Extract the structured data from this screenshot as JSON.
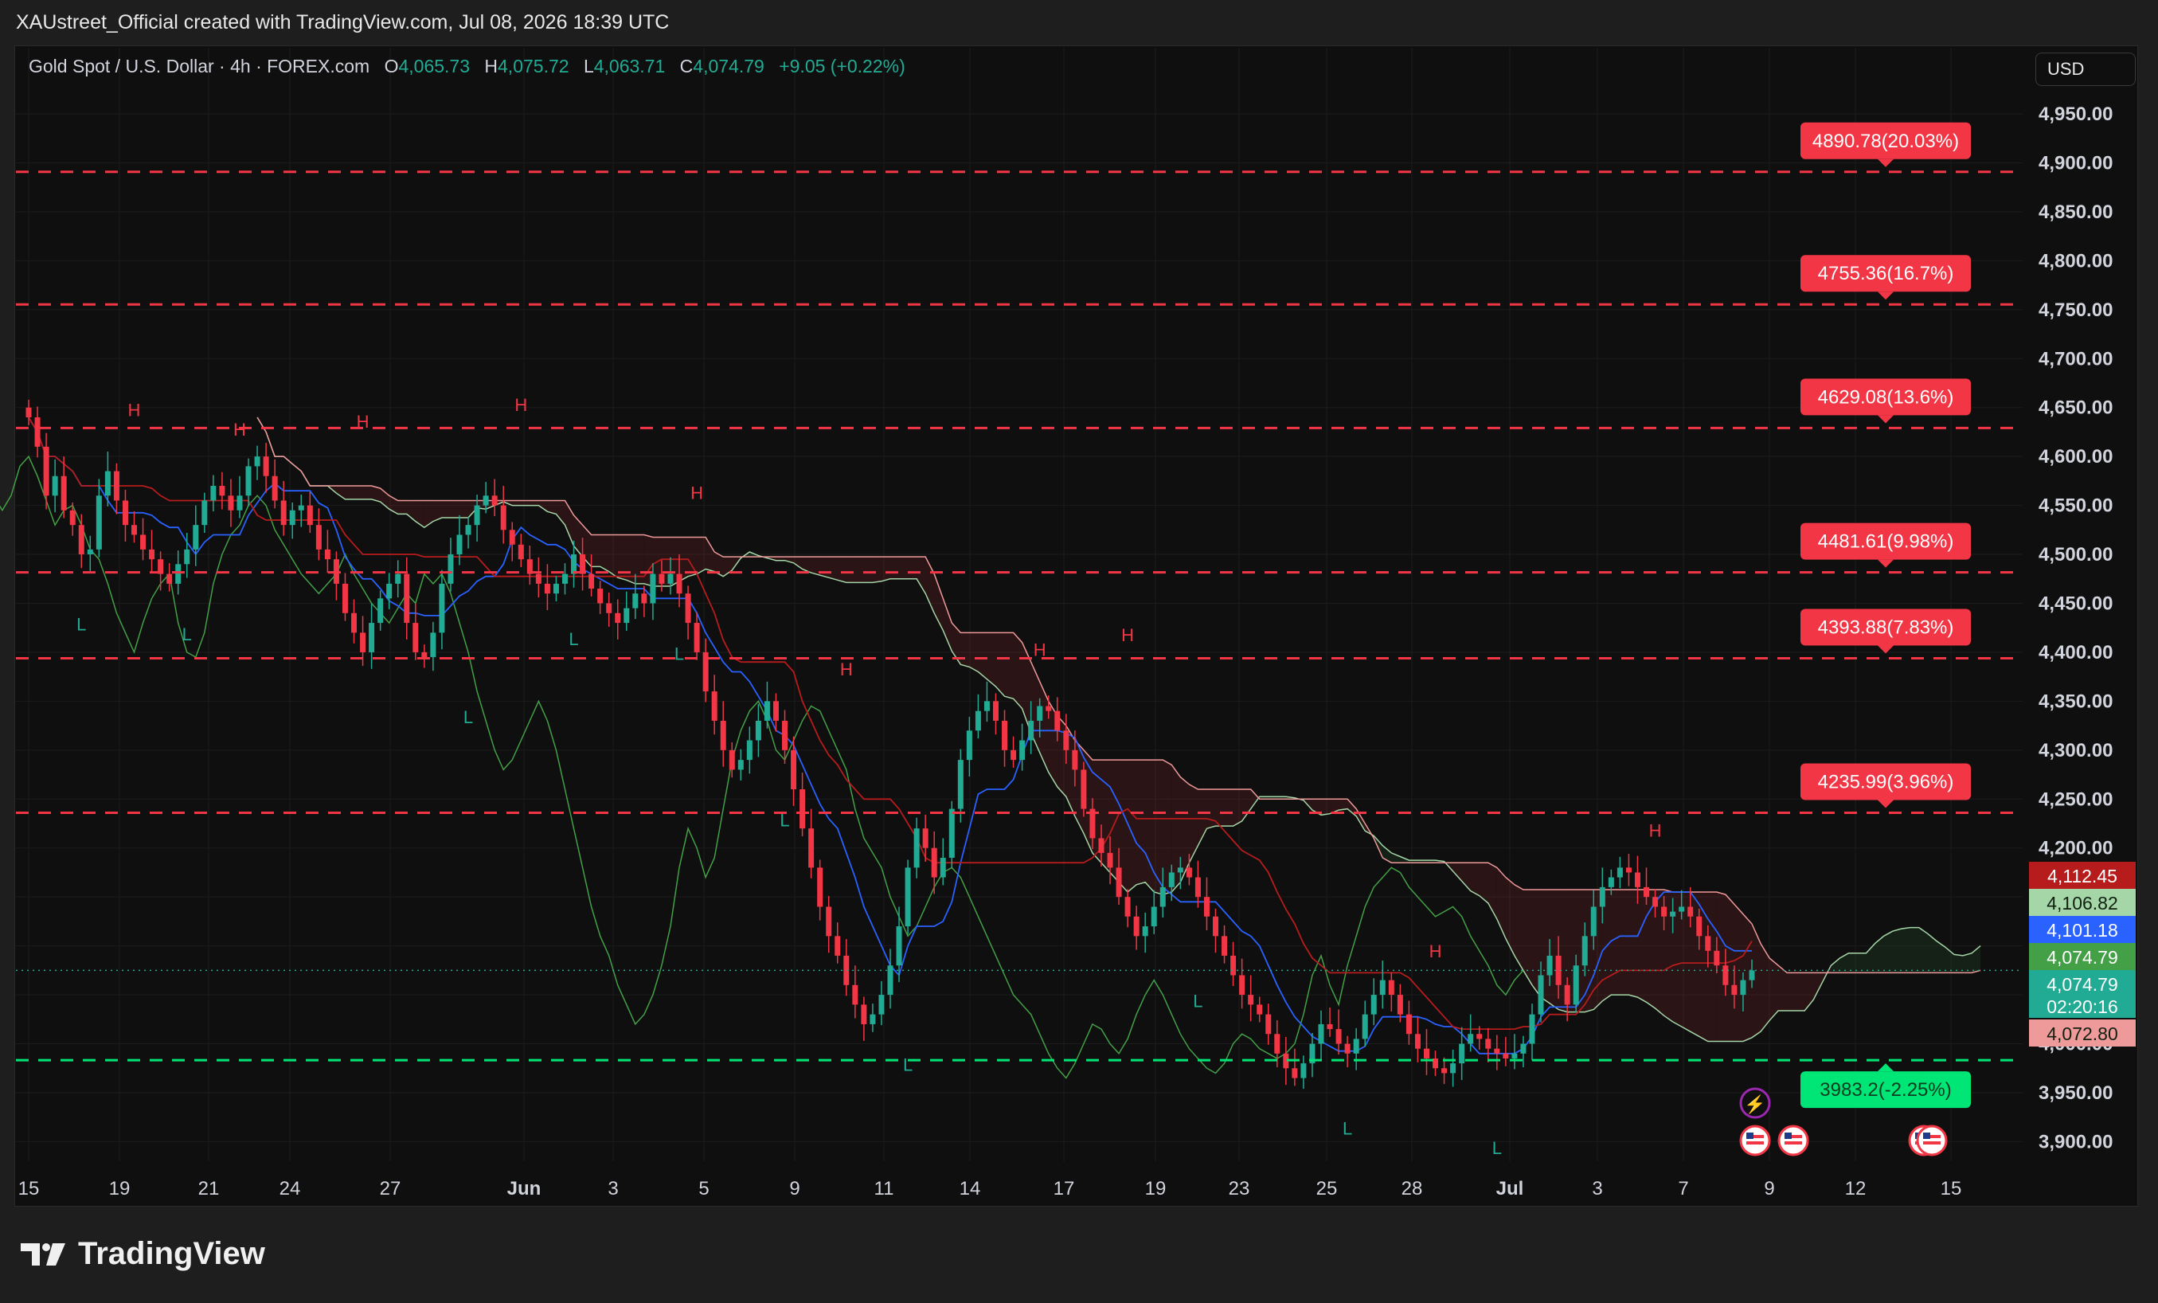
{
  "header": {
    "attribution": "XAUstreet_Official created with TradingView.com, Jul 08, 2026 18:39 UTC"
  },
  "legend": {
    "symbol": "Gold Spot / U.S. Dollar · 4h · FOREX.com",
    "o_label": "O",
    "o_value": "4,065.73",
    "h_label": "H",
    "h_value": "4,075.72",
    "l_label": "L",
    "l_value": "4,063.71",
    "c_label": "C",
    "c_value": "4,074.79",
    "change": "+9.05 (+0.22%)"
  },
  "currency_button": {
    "label": "USD"
  },
  "brand": {
    "name": "TradingView",
    "icon": "tradingview-logo-icon"
  },
  "colors": {
    "up": "#22ab94",
    "down": "#f23645",
    "tenkan": "#2962ff",
    "kijun": "#b71c1c",
    "chikou": "#43a047",
    "span_a": "#a5d6a7",
    "span_b": "#ef9a9a",
    "target_line": "#f23645",
    "stop_line": "#00e676"
  },
  "chart_data": {
    "type": "candlestick",
    "title": "Gold Spot / U.S. Dollar · 4h · FOREX.com",
    "currency": "USD",
    "ylim": [
      3880,
      4985
    ],
    "y_ticks": [
      "4,950.00",
      "4,900.00",
      "4,850.00",
      "4,800.00",
      "4,750.00",
      "4,700.00",
      "4,650.00",
      "4,600.00",
      "4,550.00",
      "4,500.00",
      "4,450.00",
      "4,400.00",
      "4,350.00",
      "4,300.00",
      "4,250.00",
      "4,200.00",
      "4,150.00",
      "4,100.00",
      "4,050.00",
      "4,000.00",
      "3,950.00",
      "3,900.00"
    ],
    "y_tick_values": [
      4950,
      4900,
      4850,
      4800,
      4750,
      4700,
      4650,
      4600,
      4550,
      4500,
      4450,
      4400,
      4350,
      4300,
      4250,
      4200,
      4150,
      4100,
      4050,
      4000,
      3950,
      3900
    ],
    "x_ticks": [
      "15",
      "19",
      "21",
      "24",
      "27",
      "Jun",
      "3",
      "5",
      "9",
      "11",
      "14",
      "17",
      "19",
      "23",
      "25",
      "28",
      "Jul",
      "3",
      "7",
      "9",
      "12",
      "15"
    ],
    "x_tick_bold": [
      false,
      false,
      false,
      false,
      false,
      true,
      false,
      false,
      false,
      false,
      false,
      false,
      false,
      false,
      false,
      false,
      true,
      false,
      false,
      false,
      false,
      false
    ],
    "levels": [
      {
        "label": "4890.78(20.03%)",
        "price": 4890.78,
        "kind": "target"
      },
      {
        "label": "4755.36(16.7%)",
        "price": 4755.36,
        "kind": "target"
      },
      {
        "label": "4629.08(13.6%)",
        "price": 4629.08,
        "kind": "target"
      },
      {
        "label": "4481.61(9.98%)",
        "price": 4481.61,
        "kind": "target"
      },
      {
        "label": "4393.88(7.83%)",
        "price": 4393.88,
        "kind": "target"
      },
      {
        "label": "4235.99(3.96%)",
        "price": 4235.99,
        "kind": "target"
      },
      {
        "label": "3983.2(-2.25%)",
        "price": 3983.2,
        "kind": "stop"
      }
    ],
    "price_tags": [
      {
        "label": "4,112.45",
        "price": 4112.45,
        "color": "#b71c1c",
        "series": "kijun"
      },
      {
        "label": "4,106.82",
        "price": 4106.82,
        "color": "#a5d6a7",
        "series": "span_a"
      },
      {
        "label": "4,101.18",
        "price": 4101.18,
        "color": "#2962ff",
        "series": "tenkan"
      },
      {
        "label": "4,074.79",
        "price": 4074.79,
        "color": "#43a047",
        "series": "chikou"
      },
      {
        "label": "4,074.79",
        "price": 4074.79,
        "color": "#22ab94",
        "series": "last_price",
        "countdown": "02:20:16"
      },
      {
        "label": "4,072.80",
        "price": 4072.8,
        "color": "#ef9a9a",
        "series": "span_b"
      }
    ],
    "pivots": [
      {
        "t": "H",
        "bar": 12,
        "price": 4630
      },
      {
        "t": "H",
        "bar": 24,
        "price": 4610
      },
      {
        "t": "H",
        "bar": 38,
        "price": 4618
      },
      {
        "t": "H",
        "bar": 56,
        "price": 4635
      },
      {
        "t": "H",
        "bar": 76,
        "price": 4545
      },
      {
        "t": "H",
        "bar": 93,
        "price": 4365
      },
      {
        "t": "H",
        "bar": 115,
        "price": 4385
      },
      {
        "t": "H",
        "bar": 125,
        "price": 4400
      },
      {
        "t": "H",
        "bar": 160,
        "price": 4077
      },
      {
        "t": "H",
        "bar": 185,
        "price": 4200
      },
      {
        "t": "L",
        "bar": 6,
        "price": 4450
      },
      {
        "t": "L",
        "bar": 18,
        "price": 4440
      },
      {
        "t": "L",
        "bar": 50,
        "price": 4355
      },
      {
        "t": "L",
        "bar": 62,
        "price": 4435
      },
      {
        "t": "L",
        "bar": 74,
        "price": 4420
      },
      {
        "t": "L",
        "bar": 86,
        "price": 4250
      },
      {
        "t": "L",
        "bar": 100,
        "price": 4000
      },
      {
        "t": "L",
        "bar": 133,
        "price": 4065
      },
      {
        "t": "L",
        "bar": 150,
        "price": 3935
      },
      {
        "t": "L",
        "bar": 167,
        "price": 3915
      }
    ],
    "indicators": [
      "Ichimoku Cloud (Tenkan, Kijun, Chikou, Senkou A/B)",
      "Pivot Points High/Low"
    ],
    "close_path": [
      4640,
      4610,
      4560,
      4580,
      4545,
      4530,
      4500,
      4505,
      4560,
      4585,
      4555,
      4530,
      4520,
      4505,
      4495,
      4480,
      4470,
      4490,
      4505,
      4530,
      4555,
      4570,
      4560,
      4545,
      4560,
      4590,
      4600,
      4580,
      4555,
      4530,
      4545,
      4550,
      4530,
      4505,
      4495,
      4470,
      4440,
      4420,
      4400,
      4430,
      4455,
      4470,
      4480,
      4430,
      4400,
      4395,
      4420,
      4470,
      4500,
      4520,
      4530,
      4550,
      4560,
      4550,
      4525,
      4510,
      4495,
      4480,
      4470,
      4460,
      4470,
      4480,
      4500,
      4480,
      4465,
      4450,
      4440,
      4430,
      4445,
      4460,
      4450,
      4480,
      4470,
      4480,
      4460,
      4430,
      4400,
      4360,
      4330,
      4300,
      4280,
      4290,
      4310,
      4330,
      4350,
      4330,
      4300,
      4260,
      4220,
      4180,
      4140,
      4110,
      4090,
      4060,
      4040,
      4020,
      4030,
      4050,
      4080,
      4120,
      4180,
      4220,
      4200,
      4170,
      4190,
      4240,
      4290,
      4320,
      4340,
      4350,
      4330,
      4300,
      4290,
      4310,
      4330,
      4345,
      4340,
      4320,
      4300,
      4280,
      4240,
      4210,
      4195,
      4180,
      4150,
      4130,
      4110,
      4120,
      4140,
      4160,
      4175,
      4180,
      4170,
      4150,
      4130,
      4110,
      4090,
      4070,
      4050,
      4040,
      4030,
      4010,
      3990,
      3975,
      3965,
      3980,
      4000,
      4020,
      4015,
      4000,
      3990,
      4005,
      4030,
      4050,
      4065,
      4050,
      4030,
      4010,
      3995,
      3985,
      3975,
      3970,
      3980,
      4000,
      4010,
      4005,
      3995,
      3990,
      3985,
      3990,
      4000,
      4030,
      4070,
      4090,
      4060,
      4040,
      4080,
      4110,
      4140,
      4160,
      4170,
      4180,
      4175,
      4160,
      4150,
      4140,
      4130,
      4135,
      4140,
      4130,
      4110,
      4095,
      4080,
      4060,
      4050,
      4065,
      4075
    ]
  }
}
